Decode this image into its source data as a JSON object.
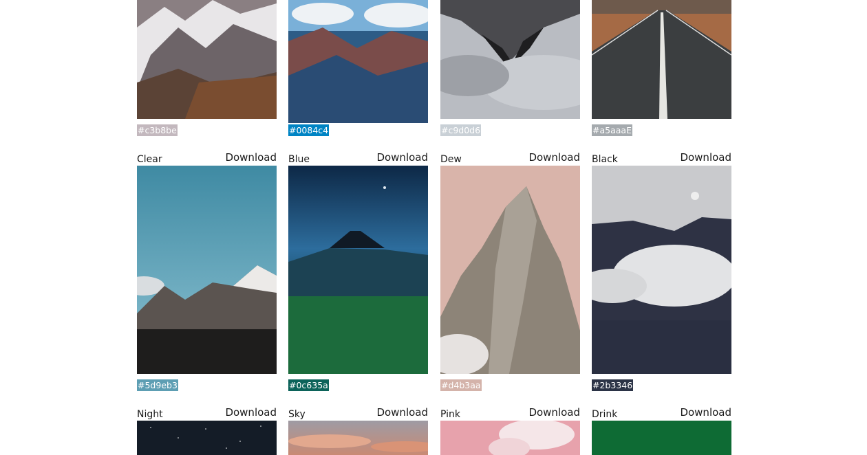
{
  "row1": [
    {
      "hex": "#c3b8be",
      "color": "#c3b8be"
    },
    {
      "hex": "#0084c4",
      "color": "#0084c4"
    },
    {
      "hex": "#c9d0d6",
      "color": "#c9d0d6"
    },
    {
      "hex": "#a5aaaE",
      "color": "#a5aaae"
    }
  ],
  "row2": [
    {
      "name": "Clear",
      "download": "Download",
      "hex": "#5d9eb3",
      "color": "#5d9eb3"
    },
    {
      "name": "Blue",
      "download": "Download",
      "hex": "#0c635a",
      "color": "#0c635a"
    },
    {
      "name": "Dew",
      "download": "Download",
      "hex": "#d4b3aa",
      "color": "#d4b3aa"
    },
    {
      "name": "Black",
      "download": "Download",
      "hex": "#2b3346",
      "color": "#2b3346"
    }
  ],
  "row3": [
    {
      "name": "Night",
      "download": "Download"
    },
    {
      "name": "Sky",
      "download": "Download"
    },
    {
      "name": "Pink",
      "download": "Download"
    },
    {
      "name": "Drink",
      "download": "Download"
    }
  ]
}
